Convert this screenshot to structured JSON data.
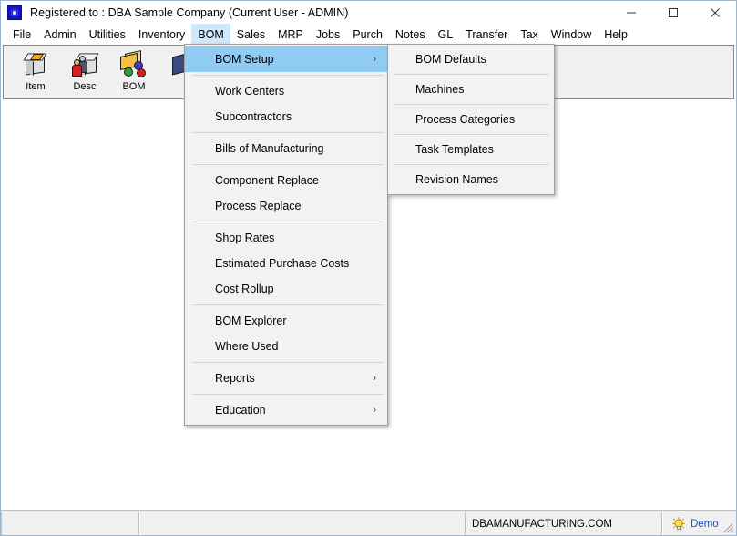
{
  "window": {
    "title": "Registered to : DBA Sample Company (Current User - ADMIN)",
    "app_icon": "app-logo-icon",
    "controls": {
      "minimize": "minimize-icon",
      "maximize": "maximize-icon",
      "close": "close-icon"
    }
  },
  "menu_bar": {
    "items": [
      {
        "label": "File",
        "active": false
      },
      {
        "label": "Admin",
        "active": false
      },
      {
        "label": "Utilities",
        "active": false
      },
      {
        "label": "Inventory",
        "active": false
      },
      {
        "label": "BOM",
        "active": true
      },
      {
        "label": "Sales",
        "active": false
      },
      {
        "label": "MRP",
        "active": false
      },
      {
        "label": "Jobs",
        "active": false
      },
      {
        "label": "Purch",
        "active": false
      },
      {
        "label": "Notes",
        "active": false
      },
      {
        "label": "GL",
        "active": false
      },
      {
        "label": "Transfer",
        "active": false
      },
      {
        "label": "Tax",
        "active": false
      },
      {
        "label": "Window",
        "active": false
      },
      {
        "label": "Help",
        "active": false
      }
    ]
  },
  "toolbar": {
    "buttons": [
      {
        "label": "Item",
        "icon": "item-box-icon"
      },
      {
        "label": "Desc",
        "icon": "customer-description-icon"
      },
      {
        "label": "BOM",
        "icon": "bom-folder-icon"
      },
      {
        "label": "",
        "icon": "partial-icon"
      }
    ]
  },
  "bom_menu": {
    "items": [
      {
        "label": "BOM Setup",
        "submenu": true,
        "selected": true,
        "separator_after": true
      },
      {
        "label": "Work Centers",
        "submenu": false,
        "selected": false,
        "separator_after": false
      },
      {
        "label": "Subcontractors",
        "submenu": false,
        "selected": false,
        "separator_after": true
      },
      {
        "label": "Bills of Manufacturing",
        "submenu": false,
        "selected": false,
        "separator_after": true
      },
      {
        "label": "Component Replace",
        "submenu": false,
        "selected": false,
        "separator_after": false
      },
      {
        "label": "Process Replace",
        "submenu": false,
        "selected": false,
        "separator_after": true
      },
      {
        "label": "Shop Rates",
        "submenu": false,
        "selected": false,
        "separator_after": false
      },
      {
        "label": "Estimated Purchase Costs",
        "submenu": false,
        "selected": false,
        "separator_after": false
      },
      {
        "label": "Cost Rollup",
        "submenu": false,
        "selected": false,
        "separator_after": true
      },
      {
        "label": "BOM Explorer",
        "submenu": false,
        "selected": false,
        "separator_after": false
      },
      {
        "label": "Where Used",
        "submenu": false,
        "selected": false,
        "separator_after": true
      },
      {
        "label": "Reports",
        "submenu": true,
        "selected": false,
        "separator_after": true
      },
      {
        "label": "Education",
        "submenu": true,
        "selected": false,
        "separator_after": false
      }
    ],
    "submenu_arrow": "›"
  },
  "bom_setup_submenu": {
    "items": [
      {
        "label": "BOM Defaults",
        "separator_after": true
      },
      {
        "label": "Machines",
        "separator_after": true
      },
      {
        "label": "Process Categories",
        "separator_after": true
      },
      {
        "label": "Task Templates",
        "separator_after": true
      },
      {
        "label": "Revision Names",
        "separator_after": false
      }
    ]
  },
  "status_bar": {
    "panel1": "",
    "panel2": "",
    "website": "DBAMANUFACTURING.COM",
    "mode_icon": "lightbulb-icon",
    "mode": "Demo",
    "resize_grip": "resize-grip-icon"
  },
  "colors": {
    "menu_highlight": "#8fcbf3",
    "menubar_active": "#cfe8fa",
    "window_border": "#9fb6cd",
    "toolbar_bg": "#f0f0f0",
    "menu_bg": "#f2f2f2",
    "demo_text": "#1150d0"
  }
}
